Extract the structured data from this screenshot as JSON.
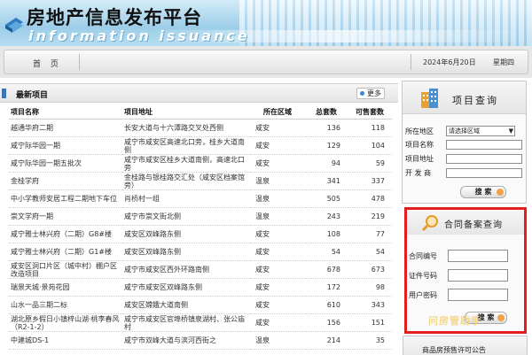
{
  "banner": {
    "title": "房地产信息发布平台",
    "subtitle": "information issuance"
  },
  "nav": {
    "home_label": "首 页",
    "date": "2024年6月20日",
    "weekday": "星期四"
  },
  "latest": {
    "title": "最新项目",
    "more_label": "更多",
    "columns": [
      "项目名称",
      "项目地址",
      "所在区域",
      "总套数",
      "可售套数"
    ],
    "rows": [
      {
        "name": "越通华府二期",
        "address": "长安大道与十六潭路交叉处西侧",
        "area": "咸安",
        "total": "136",
        "available": "118"
      },
      {
        "name": "咸宁际华园一期",
        "address": "咸宁市咸安区高速北口旁，桂乡大道南侧",
        "area": "咸安",
        "total": "129",
        "available": "104"
      },
      {
        "name": "咸宁际华园一期五批次",
        "address": "咸宁市咸安区桂乡大道南侧，高速北口旁",
        "area": "咸安",
        "total": "94",
        "available": "59"
      },
      {
        "name": "金桂学府",
        "address": "金桂路与银桂路交汇处（咸安区档案馆旁）",
        "area": "温泉",
        "total": "341",
        "available": "337"
      },
      {
        "name": "中小学教师安居工程二期地下车位",
        "address": "肖桥村一组",
        "area": "温泉",
        "total": "505",
        "available": "478"
      },
      {
        "name": "崇文学府一期",
        "address": "咸宁市崇文街北侧",
        "area": "温泉",
        "total": "243",
        "available": "219"
      },
      {
        "name": "咸宁雅士林兴府（二期）G8#楼",
        "address": "咸安区双峰路东侧",
        "area": "咸安",
        "total": "108",
        "available": "77"
      },
      {
        "name": "咸宁雅士林兴府（二期）G1#楼",
        "address": "咸安区双峰路东侧",
        "area": "咸安",
        "total": "54",
        "available": "54"
      },
      {
        "name": "咸安区洞口片区（城中村）棚户区改造项目",
        "address": "咸宁市咸安区西外环路南侧",
        "area": "咸安",
        "total": "678",
        "available": "673"
      },
      {
        "name": "瑞景天城·景苑花园",
        "address": "咸宁市咸安区双峰路东侧",
        "area": "咸安",
        "total": "172",
        "available": "98"
      },
      {
        "name": "山水一品三期二标",
        "address": "咸安区嫦娥大道南侧",
        "area": "咸安",
        "total": "610",
        "available": "343"
      },
      {
        "name": "湖北原乡假日小镇梓山湖·桃李春风（R2-1-2）",
        "address": "咸宁市咸安区官埠桥镇泉湖村、张公庙村",
        "area": "咸安",
        "total": "156",
        "available": "151"
      },
      {
        "name": "中建城DS-1",
        "address": "咸宁市双峰大道与滨河西街之",
        "area": "温泉",
        "total": "214",
        "available": "35"
      }
    ]
  },
  "project_search": {
    "title": "项目查询",
    "district_label": "所在地区",
    "district_select": "请选择区域",
    "name_label": "项目名称",
    "address_label": "项目地址",
    "developer_label": "开 发 商",
    "search_label": "搜 索"
  },
  "contract_search": {
    "title": "合同备案查询",
    "contract_no_label": "合同编号",
    "id_no_label": "证件号码",
    "password_label": "用户密码",
    "search_label": "搜 索"
  },
  "watermark": "问房管助手",
  "presale_notice": "商品房预售许可公告"
}
